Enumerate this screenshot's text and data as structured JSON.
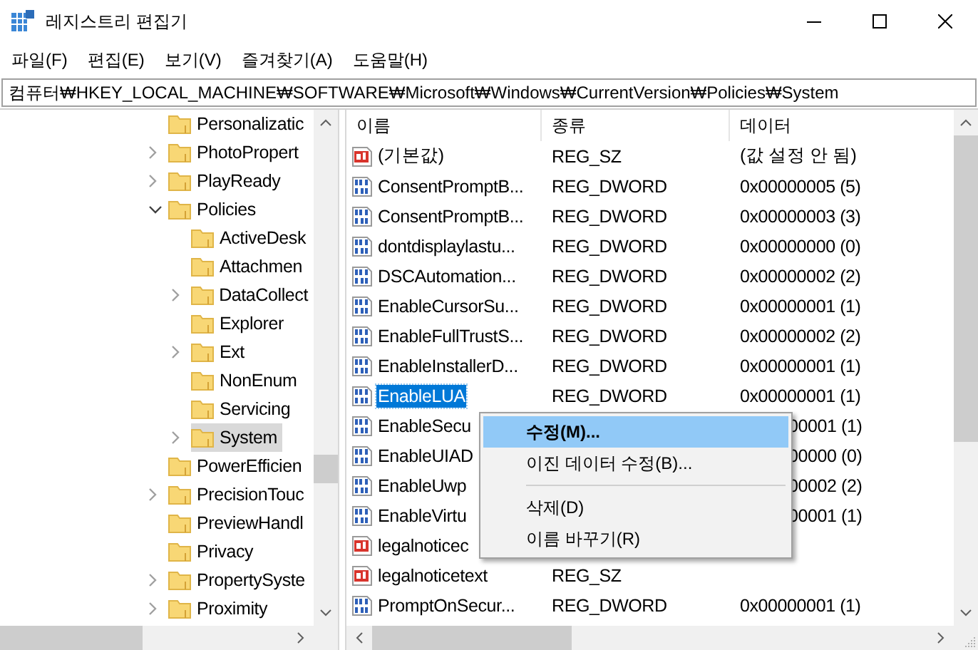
{
  "window": {
    "title": "레지스트리 편집기"
  },
  "menu": [
    "파일(F)",
    "편집(E)",
    "보기(V)",
    "즐겨찾기(A)",
    "도움말(H)"
  ],
  "address": "컴퓨터₩HKEY_LOCAL_MACHINE₩SOFTWARE₩Microsoft₩Windows₩CurrentVersion₩Policies₩System",
  "tree": [
    {
      "kind": "leaf",
      "label": "Personalizatic",
      "selected": false
    },
    {
      "kind": "branch",
      "label": "PhotoPropert",
      "expanded": false,
      "selected": false
    },
    {
      "kind": "branch",
      "label": "PlayReady",
      "expanded": false,
      "selected": false
    },
    {
      "kind": "branch",
      "label": "Policies",
      "expanded": true,
      "selected": false,
      "children": [
        {
          "kind": "leaf",
          "label": "ActiveDesk",
          "selected": false
        },
        {
          "kind": "leaf",
          "label": "Attachmen",
          "selected": false
        },
        {
          "kind": "branch",
          "label": "DataCollect",
          "expanded": false,
          "selected": false
        },
        {
          "kind": "leaf",
          "label": "Explorer",
          "selected": false
        },
        {
          "kind": "branch",
          "label": "Ext",
          "expanded": false,
          "selected": false
        },
        {
          "kind": "leaf",
          "label": "NonEnum",
          "selected": false
        },
        {
          "kind": "leaf",
          "label": "Servicing",
          "selected": false
        },
        {
          "kind": "branch",
          "label": "System",
          "expanded": false,
          "selected": true
        }
      ]
    },
    {
      "kind": "leaf",
      "label": "PowerEfficien",
      "selected": false
    },
    {
      "kind": "branch",
      "label": "PrecisionTouc",
      "expanded": false,
      "selected": false
    },
    {
      "kind": "leaf",
      "label": "PreviewHandl",
      "selected": false
    },
    {
      "kind": "leaf",
      "label": "Privacy",
      "selected": false
    },
    {
      "kind": "branch",
      "label": "PropertySyste",
      "expanded": false,
      "selected": false
    },
    {
      "kind": "branch",
      "label": "Proximity",
      "expanded": false,
      "selected": false
    }
  ],
  "table": {
    "columns": [
      "이름",
      "종류",
      "데이터"
    ],
    "rows": [
      {
        "kind": "sz",
        "name": "(기본값)",
        "type": "REG_SZ",
        "data": "(값 설정 안 됨)",
        "selected": false
      },
      {
        "kind": "dword",
        "name": "ConsentPromptB...",
        "type": "REG_DWORD",
        "data": "0x00000005 (5)",
        "selected": false
      },
      {
        "kind": "dword",
        "name": "ConsentPromptB...",
        "type": "REG_DWORD",
        "data": "0x00000003 (3)",
        "selected": false
      },
      {
        "kind": "dword",
        "name": "dontdisplaylastu...",
        "type": "REG_DWORD",
        "data": "0x00000000 (0)",
        "selected": false
      },
      {
        "kind": "dword",
        "name": "DSCAutomation...",
        "type": "REG_DWORD",
        "data": "0x00000002 (2)",
        "selected": false
      },
      {
        "kind": "dword",
        "name": "EnableCursorSu...",
        "type": "REG_DWORD",
        "data": "0x00000001 (1)",
        "selected": false
      },
      {
        "kind": "dword",
        "name": "EnableFullTrustS...",
        "type": "REG_DWORD",
        "data": "0x00000002 (2)",
        "selected": false
      },
      {
        "kind": "dword",
        "name": "EnableInstallerD...",
        "type": "REG_DWORD",
        "data": "0x00000001 (1)",
        "selected": false
      },
      {
        "kind": "dword",
        "name": "EnableLUA",
        "type": "REG_DWORD",
        "data": "0x00000001 (1)",
        "selected": true
      },
      {
        "kind": "dword",
        "name": "EnableSecu",
        "data": "00001 (1)",
        "selected": false
      },
      {
        "kind": "dword",
        "name": "EnableUIAD",
        "data": "00000 (0)",
        "selected": false
      },
      {
        "kind": "dword",
        "name": "EnableUwp",
        "data": "00002 (2)",
        "selected": false
      },
      {
        "kind": "dword",
        "name": "EnableVirtu",
        "data": "00001 (1)",
        "selected": false
      },
      {
        "kind": "sz",
        "name": "legalnoticec",
        "selected": false
      },
      {
        "kind": "sz",
        "name": "legalnoticetext",
        "type": "REG_SZ",
        "selected": false
      },
      {
        "kind": "dword",
        "name": "PromptOnSecur...",
        "type": "REG_DWORD",
        "data": "0x00000001 (1)",
        "selected": false
      }
    ]
  },
  "context_menu": [
    {
      "label": "수정(M)...",
      "kind": "item",
      "selected": true
    },
    {
      "label": "이진 데이터 수정(B)...",
      "kind": "item",
      "selected": false
    },
    {
      "kind": "separator"
    },
    {
      "label": "삭제(D)",
      "kind": "item",
      "selected": false
    },
    {
      "label": "이름 바꾸기(R)",
      "kind": "item",
      "selected": false
    }
  ]
}
